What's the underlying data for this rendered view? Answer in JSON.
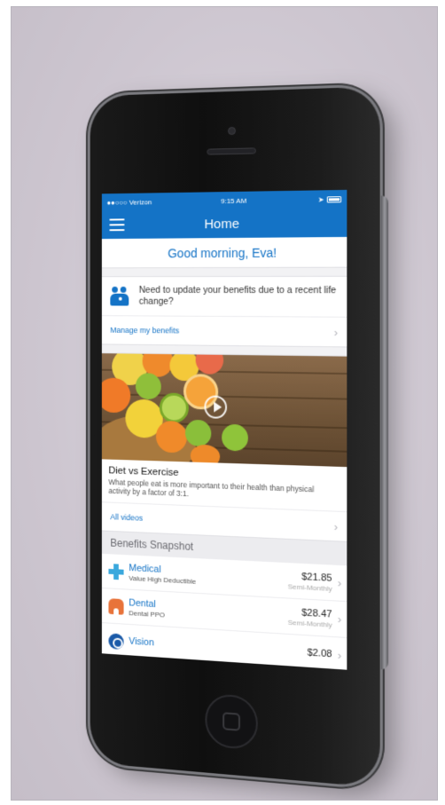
{
  "status_bar": {
    "carrier": "●●○○○ Verizon",
    "time": "9:15 AM"
  },
  "nav": {
    "title": "Home"
  },
  "greeting": "Good morning, Eva!",
  "life_change": {
    "message": "Need to update your benefits due to a recent life change?",
    "link": "Manage my benefits"
  },
  "video": {
    "title": "Diet vs Exercise",
    "description": "What people eat is more important to their health than physical activity by a factor of 3:1.",
    "link": "All videos"
  },
  "benefits": {
    "header": "Benefits Snapshot",
    "items": [
      {
        "name": "Medical",
        "plan": "Value High Deductible",
        "amount": "$21.85",
        "frequency": "Semi-Monthly",
        "icon": "medical-cross-icon",
        "color": "#3aa8dd"
      },
      {
        "name": "Dental",
        "plan": "Dental PPO",
        "amount": "$28.47",
        "frequency": "Semi-Monthly",
        "icon": "tooth-icon",
        "color": "#e8733a"
      },
      {
        "name": "Vision",
        "plan": "",
        "amount": "$2.08",
        "frequency": "",
        "icon": "eye-icon",
        "color": "#1a5aa8"
      }
    ]
  },
  "colors": {
    "brand_blue": "#1473c6",
    "background": "#f2f2f4"
  }
}
